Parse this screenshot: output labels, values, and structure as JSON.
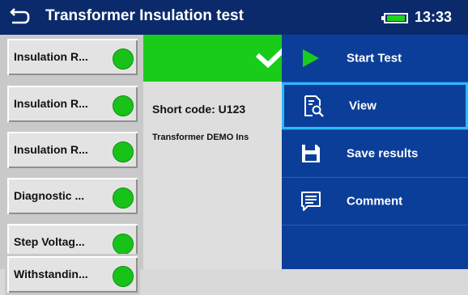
{
  "header": {
    "title": "Transformer Insulation test",
    "time": "13:33"
  },
  "sidebar": {
    "items": [
      {
        "label": "Insulation R..."
      },
      {
        "label": "Insulation R..."
      },
      {
        "label": "Insulation R..."
      },
      {
        "label": "Diagnostic ..."
      },
      {
        "label": "Step Voltag..."
      },
      {
        "label": "Withstandin..."
      }
    ]
  },
  "detail": {
    "short_code": "Short code: U123",
    "description": "Transformer DEMO Ins"
  },
  "menu": {
    "items": [
      {
        "label": "Start Test"
      },
      {
        "label": "View"
      },
      {
        "label": "Save results"
      },
      {
        "label": "Comment"
      }
    ]
  },
  "colors": {
    "header": "#0a2a6b",
    "status_pass": "#1acc1a",
    "menu_bg": "#0b3e99",
    "menu_selected_border": "#2ab8ff",
    "led": "#19c219"
  }
}
